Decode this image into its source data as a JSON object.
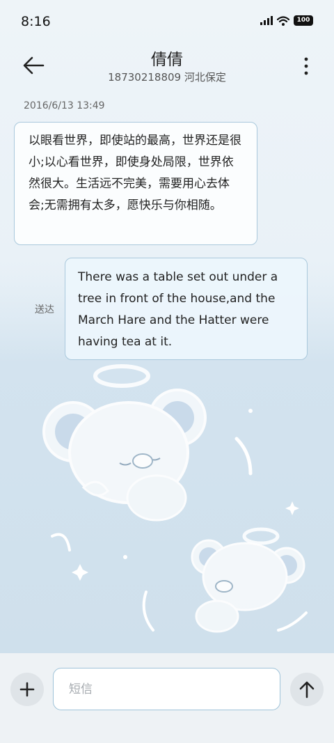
{
  "status_bar": {
    "time": "8:16",
    "battery": "100",
    "icons": [
      "signal-icon",
      "wifi-icon",
      "battery-icon"
    ]
  },
  "header": {
    "contact_name": "倩倩",
    "contact_subtitle": "18730218809 河北保定",
    "back_icon": "arrow-left-icon",
    "more_icon": "more-vertical-icon"
  },
  "conversation": {
    "timestamp": "2016/6/13 13:49",
    "messages": [
      {
        "direction": "incoming",
        "text": "以眼看世界，即使站的最高，世界还是很小;以心看世界，即使身处局限，世界依然很大。生活远不完美，需要用心去体会;无需拥有太多，愿快乐与你相随。"
      },
      {
        "direction": "outgoing",
        "text": "There was a table set out under a tree in front of the house,and the March Hare and the Hatter were having tea at it.",
        "status": "送达"
      }
    ]
  },
  "compose": {
    "placeholder": "短信",
    "value": "",
    "add_icon": "plus-icon",
    "send_icon": "arrow-up-icon"
  },
  "theme": {
    "accent": "#9fc3d9",
    "bubble_border": "#a9c8dc",
    "background": "#e9f1f7"
  }
}
